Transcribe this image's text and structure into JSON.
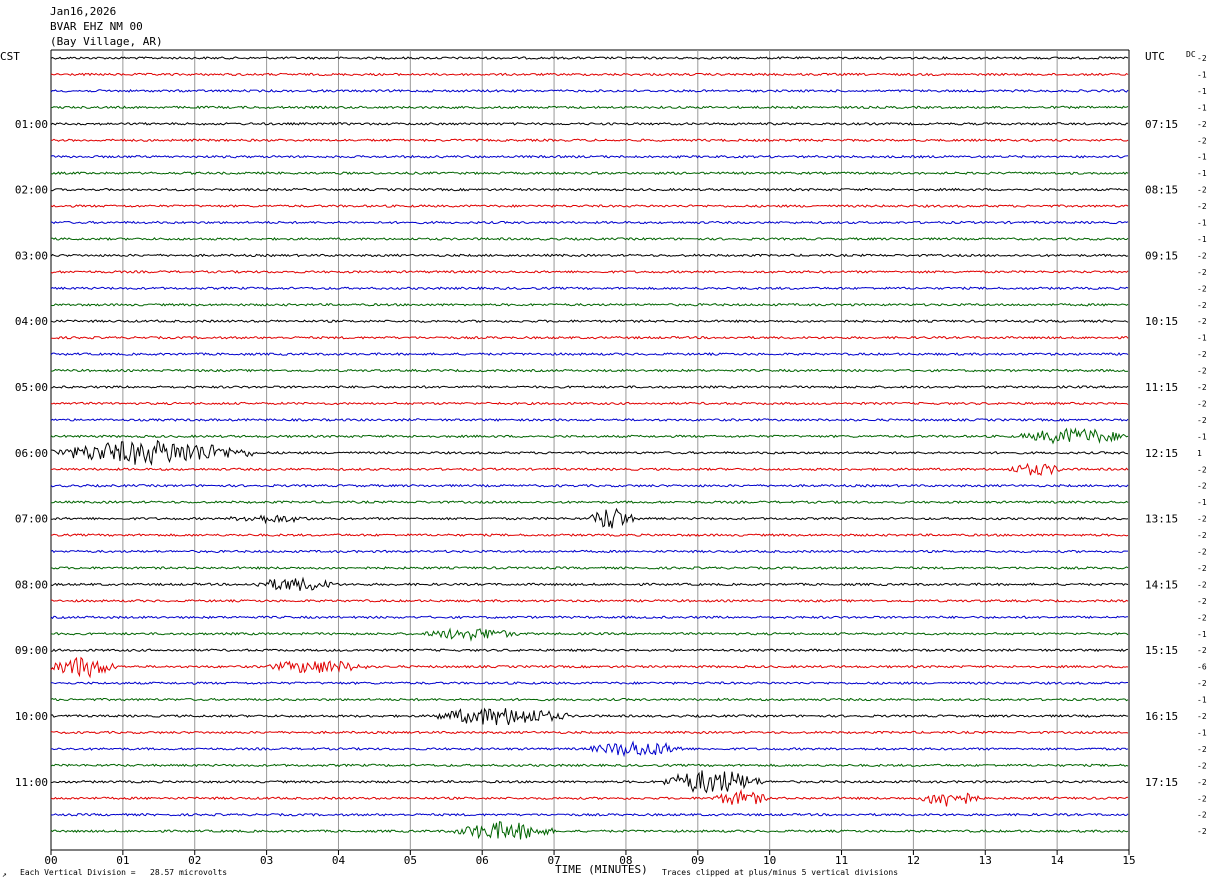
{
  "header": {
    "date": "Jan16,2026",
    "station": "BVAR EHZ NM 00",
    "location": "(Bay Village, AR)"
  },
  "labels": {
    "left_zone": "CST",
    "right_zone": "UTC",
    "dc": "DC",
    "x_title": "TIME (MINUTES)",
    "scale_note": "Each Vertical Division =   28.57 microvolts",
    "clip_note": "Traces clipped at plus/minus 5 vertical divisions",
    "corner_mark": "↗"
  },
  "colors": {
    "black": "#000000",
    "red": "#e00000",
    "blue": "#0000cc",
    "green": "#006400",
    "grid": "#999999"
  },
  "chart_data": {
    "type": "line",
    "title": "BVAR EHZ NM 00 (Bay Village, AR) — Jan16,2026",
    "xlabel": "TIME (MINUTES)",
    "xlim": [
      0,
      15
    ],
    "x_ticks": [
      "00",
      "01",
      "02",
      "03",
      "04",
      "05",
      "06",
      "07",
      "08",
      "09",
      "10",
      "11",
      "12",
      "13",
      "14",
      "15"
    ],
    "row_minutes": 15,
    "rows": 48,
    "left_hour_labels": [
      "01:00",
      "02:00",
      "03:00",
      "04:00",
      "05:00",
      "06:00",
      "07:00",
      "08:00",
      "09:00",
      "10:00",
      "11:00"
    ],
    "right_hour_labels": [
      "07:15",
      "08:15",
      "09:15",
      "10:15",
      "11:15",
      "12:15",
      "13:15",
      "14:15",
      "15:15",
      "16:15",
      "17:15"
    ],
    "hour_label_rows": [
      4,
      8,
      12,
      16,
      20,
      24,
      28,
      32,
      36,
      40,
      44
    ],
    "row_colors": [
      "black",
      "red",
      "blue",
      "green"
    ],
    "dc_offsets": [
      "-2",
      "-1",
      "-1",
      "-1",
      "-2",
      "-2",
      "-1",
      "-1",
      "-2",
      "-2",
      "-1",
      "-1",
      "-2",
      "-2",
      "-2",
      "-2",
      "-2",
      "-1",
      "-2",
      "-2",
      "-2",
      "-2",
      "-2",
      "-1",
      "1",
      "-2",
      "-2",
      "-1",
      "-2",
      "-2",
      "-2",
      "-2",
      "-2",
      "-2",
      "-2",
      "-1",
      "-2",
      "-6",
      "-2",
      "-1",
      "-2",
      "-1",
      "-2",
      "-2",
      "-2",
      "-2",
      "-2",
      "-2"
    ],
    "events": [
      {
        "row": 24,
        "start_min": 0.0,
        "end_min": 2.8,
        "amplitude": 3.5
      },
      {
        "row": 23,
        "start_min": 13.5,
        "end_min": 15.0,
        "amplitude": 2.2
      },
      {
        "row": 25,
        "start_min": 13.3,
        "end_min": 14.1,
        "amplitude": 1.6
      },
      {
        "row": 28,
        "start_min": 2.5,
        "end_min": 3.6,
        "amplitude": 1.0
      },
      {
        "row": 28,
        "start_min": 7.5,
        "end_min": 8.1,
        "amplitude": 3.5
      },
      {
        "row": 32,
        "start_min": 2.8,
        "end_min": 4.0,
        "amplitude": 1.8
      },
      {
        "row": 35,
        "start_min": 5.2,
        "end_min": 6.5,
        "amplitude": 1.6
      },
      {
        "row": 37,
        "start_min": 0.0,
        "end_min": 0.9,
        "amplitude": 3.0
      },
      {
        "row": 37,
        "start_min": 3.0,
        "end_min": 4.4,
        "amplitude": 1.8
      },
      {
        "row": 40,
        "start_min": 5.3,
        "end_min": 7.2,
        "amplitude": 2.6
      },
      {
        "row": 42,
        "start_min": 7.5,
        "end_min": 8.8,
        "amplitude": 2.2
      },
      {
        "row": 44,
        "start_min": 8.5,
        "end_min": 9.9,
        "amplitude": 3.5
      },
      {
        "row": 45,
        "start_min": 9.2,
        "end_min": 10.0,
        "amplitude": 2.0
      },
      {
        "row": 45,
        "start_min": 12.1,
        "end_min": 12.9,
        "amplitude": 2.5
      },
      {
        "row": 47,
        "start_min": 5.6,
        "end_min": 7.0,
        "amplitude": 2.6
      }
    ]
  }
}
